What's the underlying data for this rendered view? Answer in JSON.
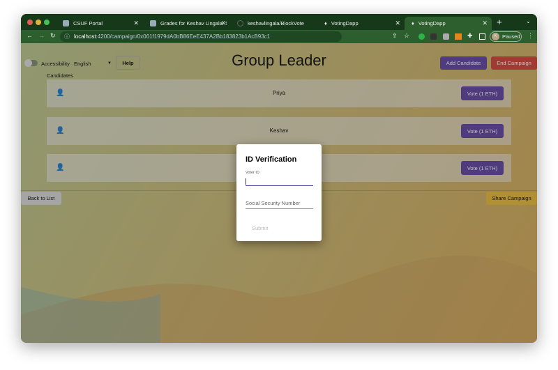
{
  "browser": {
    "tabs": [
      {
        "title": "CSUF Portal"
      },
      {
        "title": "Grades for Keshav Lingala: Sp"
      },
      {
        "title": "keshavlingala/BlockVote"
      },
      {
        "title": "VotingDapp"
      },
      {
        "title": "VotingDapp",
        "active": true
      }
    ],
    "url_host": "localhost",
    "url_path": ":4200/campaign/0x061f1979dA0bB86EeE437A2Bb183823b1AcB93c1",
    "profile_label": "Paused",
    "profile_initial": "K"
  },
  "toolbar": {
    "accessibility_label": "Accessibility",
    "language": "English",
    "help_label": "Help"
  },
  "page": {
    "title": "Group Leader",
    "add_candidate": "Add Candidate",
    "end_campaign": "End Campaign",
    "candidates_label": "Candidates",
    "back": "Back to List",
    "share": "Share Campaign"
  },
  "candidates": [
    {
      "name": "Priya",
      "vote": "Vote (1 ETH)"
    },
    {
      "name": "Keshav",
      "vote": "Vote (1 ETH)"
    },
    {
      "name": "",
      "vote": "Vote (1 ETH)"
    }
  ],
  "modal": {
    "title": "ID Verification",
    "voter_id_label": "Voter ID",
    "voter_id_value": "",
    "ssn_placeholder": "Social Security Number",
    "submit": "Submit"
  },
  "colors": {
    "accent": "#5b3b9e",
    "danger": "#d03a2e",
    "share": "#e8b830"
  }
}
